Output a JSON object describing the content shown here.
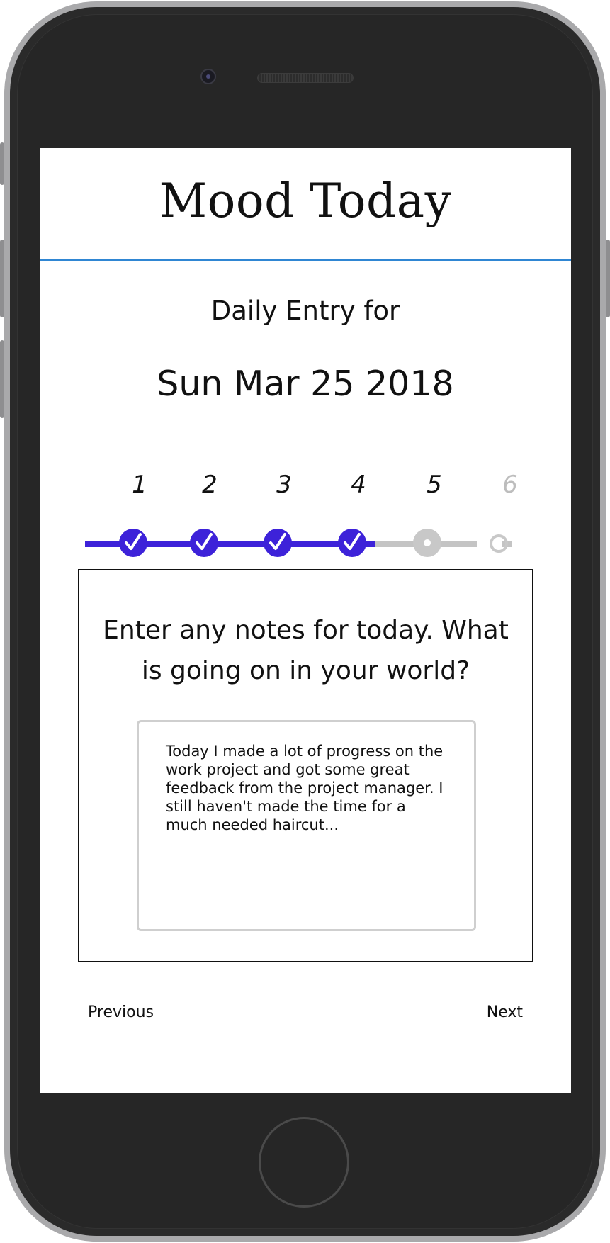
{
  "app": {
    "title": "Mood Today"
  },
  "entry": {
    "label": "Daily Entry for",
    "date": "Sun Mar 25 2018"
  },
  "stepper": {
    "steps": [
      {
        "label": "1",
        "state": "done"
      },
      {
        "label": "2",
        "state": "done"
      },
      {
        "label": "3",
        "state": "done"
      },
      {
        "label": "4",
        "state": "done"
      },
      {
        "label": "5",
        "state": "current"
      },
      {
        "label": "6",
        "state": "pending"
      }
    ]
  },
  "question": {
    "prompt": "Enter any notes for today. What is going on in your world?",
    "notes_value": "Today I made a lot of progress on the work project and got some great feedback from the project manager. I still haven't made the time for a much needed haircut..."
  },
  "navigation": {
    "previous_label": "Previous",
    "next_label": "Next"
  },
  "colors": {
    "accent": "#3d22d9",
    "header_rule": "#2f86d3",
    "inactive": "#c4c4c4"
  },
  "icons": {
    "done": "check-icon",
    "current": "radio-dot-icon",
    "pending": "circle-outline-icon"
  }
}
